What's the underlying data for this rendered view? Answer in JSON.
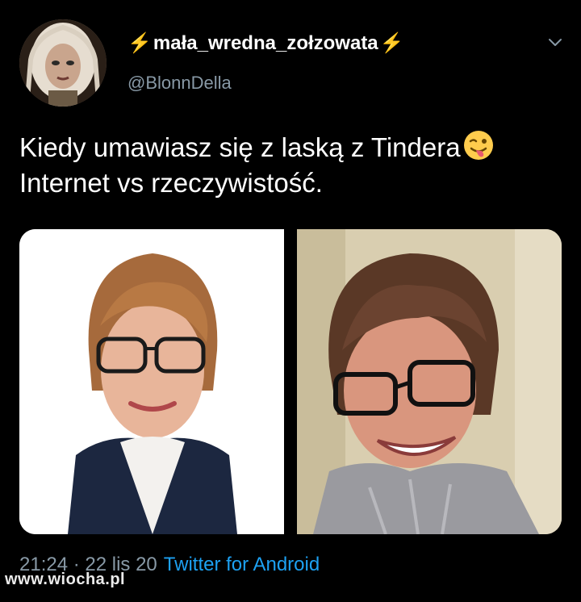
{
  "tweet": {
    "author": {
      "display_name": "mała_wredna_zołzowata",
      "display_name_prefix_icon": "lightning-bolt",
      "display_name_suffix_icon": "lightning-bolt",
      "handle": "@BlonnDella",
      "avatar_icon": "profile-avatar"
    },
    "menu_icon": "chevron-down",
    "text_line_1": "Kiedy umawiasz się z laską z Tindera",
    "text_emoji": "winking-face-with-tongue",
    "text_line_2": "Internet vs rzeczywistość.",
    "media": [
      {
        "kind": "photo",
        "icon": "portrait-photo"
      },
      {
        "kind": "photo",
        "icon": "portrait-photo"
      }
    ],
    "timestamp": "21:24 · 22 lis 20",
    "separator": "·",
    "source": "Twitter for Android"
  },
  "watermark": "www.wiocha.pl",
  "colors": {
    "background": "#000000",
    "text": "#ffffff",
    "secondary_text": "#8899a6",
    "link": "#1da1f2",
    "bolt": "#ffc83d"
  }
}
